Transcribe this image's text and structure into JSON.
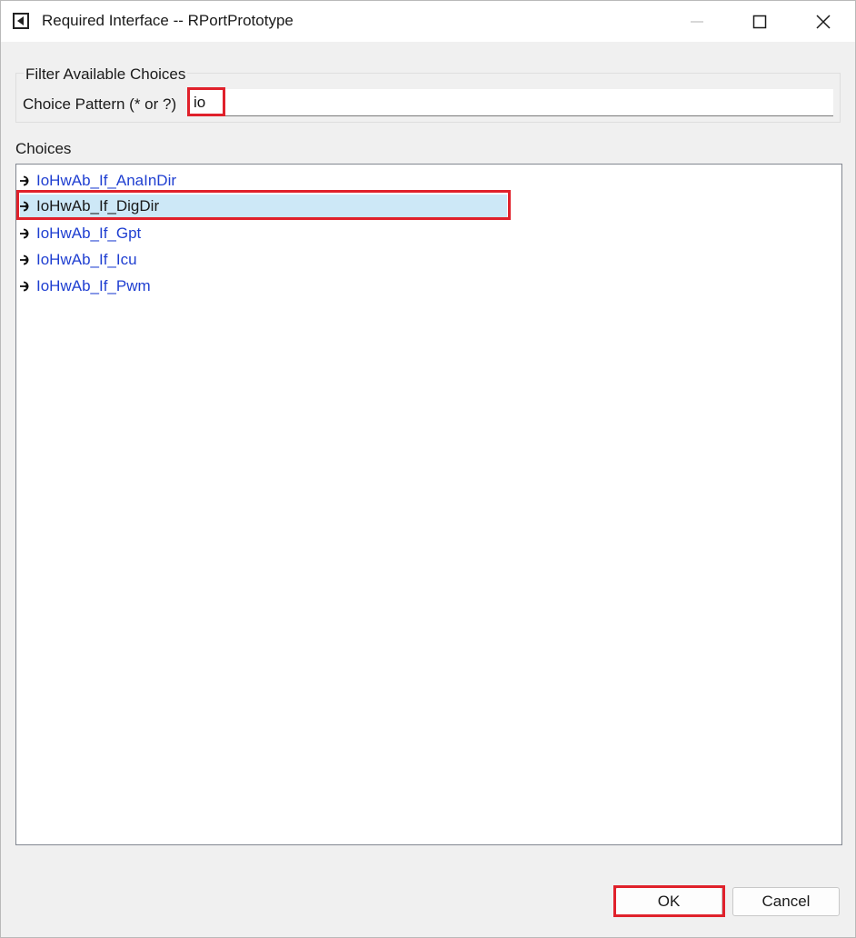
{
  "window": {
    "title": "Required Interface -- RPortPrototype",
    "app_icon": "left-arrow-box-icon",
    "controls": {
      "minimize": "minimize-icon",
      "maximize": "maximize-icon",
      "close": "close-icon"
    }
  },
  "filter": {
    "legend": "Filter Available Choices",
    "pattern_label": "Choice Pattern (* or ?)",
    "pattern_value": "io"
  },
  "choices": {
    "label": "Choices",
    "item_icon": "interface-port-icon",
    "items": [
      {
        "label": "IoHwAb_If_AnaInDir",
        "selected": false
      },
      {
        "label": "IoHwAb_If_DigDir",
        "selected": true
      },
      {
        "label": "IoHwAb_If_Gpt",
        "selected": false
      },
      {
        "label": "IoHwAb_If_Icu",
        "selected": false
      },
      {
        "label": "IoHwAb_If_Pwm",
        "selected": false
      }
    ]
  },
  "buttons": {
    "ok": "OK",
    "cancel": "Cancel"
  },
  "colors": {
    "highlight_box": "#e0212b",
    "selection_bg": "#cde8f7",
    "link_text": "#1f3fd1"
  }
}
